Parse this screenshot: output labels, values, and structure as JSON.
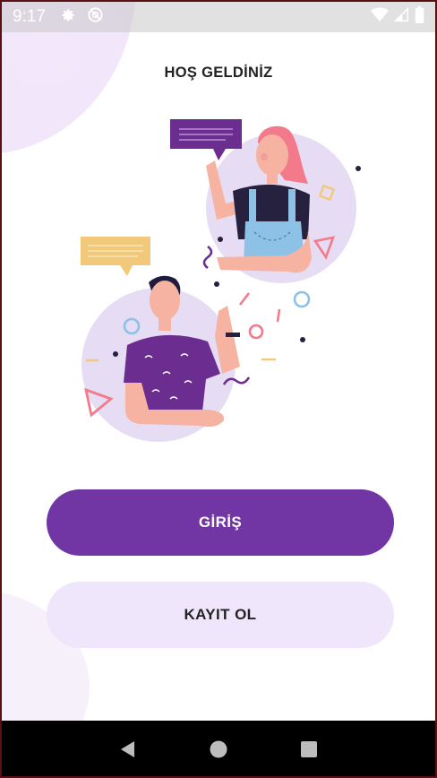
{
  "status_bar": {
    "time": "9:17",
    "icons_left": [
      "gear-icon",
      "sync-icon"
    ],
    "icons_right": [
      "wifi-icon",
      "signal-icon",
      "battery-icon"
    ]
  },
  "welcome": {
    "title": "HOŞ GELDİNİZ",
    "illustration": "two-people-chatting-illustration"
  },
  "actions": {
    "login_label": "GİRİŞ",
    "register_label": "KAYIT OL"
  },
  "nav_bar": {
    "icons": [
      "back-icon",
      "home-icon",
      "recents-icon"
    ]
  },
  "colors": {
    "primary": "#7136a4",
    "secondary_button": "#efe6fb",
    "speech_bubble_purple": "#6b2d8f",
    "speech_bubble_yellow": "#f2c97a",
    "circle_lavender": "#e6dcf3"
  }
}
